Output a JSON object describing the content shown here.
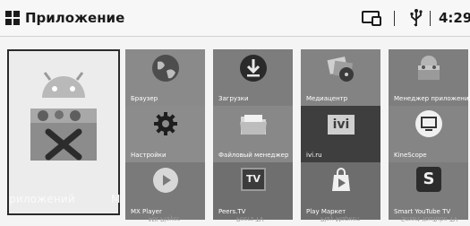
{
  "header": {
    "title": "Приложение",
    "time": "4:29",
    "icons": [
      "apps-grid-icon",
      "screen-mirror-icon",
      "usb-icon"
    ]
  },
  "featured": {
    "label": "риложений",
    "label_tail": "М",
    "icon": "android-toolbox-icon"
  },
  "tiles": [
    {
      "label": "Браузер",
      "icon": "globe-icon"
    },
    {
      "label": "Загрузки",
      "icon": "download-icon"
    },
    {
      "label": "Медиацентр",
      "icon": "media-icon"
    },
    {
      "label": "Менеджер приложений",
      "icon": "android-icon"
    },
    {
      "label": "Настройки",
      "icon": "gear-icon"
    },
    {
      "label": "Файловый менеджер",
      "icon": "folder-icon"
    },
    {
      "label": "ivi.ru",
      "icon": "ivi-icon"
    },
    {
      "label": "KineScope",
      "icon": "monitor-icon"
    },
    {
      "label": "MX Player",
      "icon": "play-icon"
    },
    {
      "label": "Peers.TV",
      "icon": "tv-icon"
    },
    {
      "label": "Play Маркет",
      "icon": "store-bag-icon"
    },
    {
      "label": "Smart YouTube TV",
      "icon": "s-icon"
    }
  ],
  "reflections": [
    "MX Player",
    "Peers TV",
    "Play Маркет",
    "Smart YouTube TV"
  ]
}
